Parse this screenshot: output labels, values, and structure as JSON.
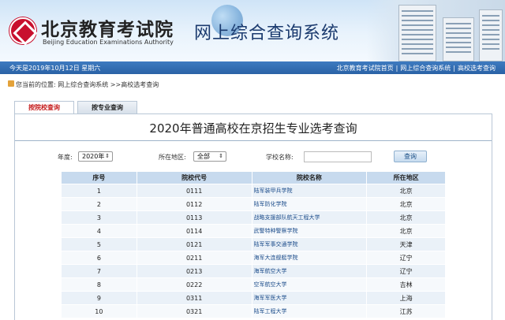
{
  "header": {
    "logo_cn": "北京教育考试院",
    "logo_en": "Beijing Education Examinations Authority",
    "site_title": "网上综合查询系统"
  },
  "topbar": {
    "date": "今天是2019年10月12日 星期六",
    "links": [
      "北京教育考试院首页",
      "网上综合查询系统",
      "高校选考查询"
    ],
    "separator": "|"
  },
  "breadcrumb": {
    "prefix": "您当前的位置:",
    "trail": "网上综合查询系统 >>高校选考查询"
  },
  "tabs": [
    {
      "label": "按院校查询",
      "active": true
    },
    {
      "label": "按专业查询",
      "active": false
    }
  ],
  "page_title": "2020年普通高校在京招生专业选考查询",
  "filters": {
    "year_label": "年度:",
    "year_value": "2020年",
    "region_label": "所在地区:",
    "region_value": "全部",
    "school_label": "学校名称:",
    "school_placeholder": "",
    "search_label": "查询"
  },
  "table": {
    "headers": [
      "序号",
      "院校代号",
      "院校名称",
      "所在地区"
    ],
    "rows": [
      [
        "1",
        "0111",
        "陆军装甲兵学院",
        "北京"
      ],
      [
        "2",
        "0112",
        "陆军防化学院",
        "北京"
      ],
      [
        "3",
        "0113",
        "战略支援部队航天工程大学",
        "北京"
      ],
      [
        "4",
        "0114",
        "武警特种警察学院",
        "北京"
      ],
      [
        "5",
        "0121",
        "陆军军事交通学院",
        "天津"
      ],
      [
        "6",
        "0211",
        "海军大连舰艇学院",
        "辽宁"
      ],
      [
        "7",
        "0213",
        "海军航空大学",
        "辽宁"
      ],
      [
        "8",
        "0222",
        "空军航空大学",
        "吉林"
      ],
      [
        "9",
        "0311",
        "海军军医大学",
        "上海"
      ],
      [
        "10",
        "0321",
        "陆军工程大学",
        "江苏"
      ]
    ]
  },
  "colors": {
    "topbar": "#2a62a6",
    "header_row": "#c7daee",
    "active_tab_text": "#c51d1d",
    "title_text": "#1a3a6e"
  }
}
